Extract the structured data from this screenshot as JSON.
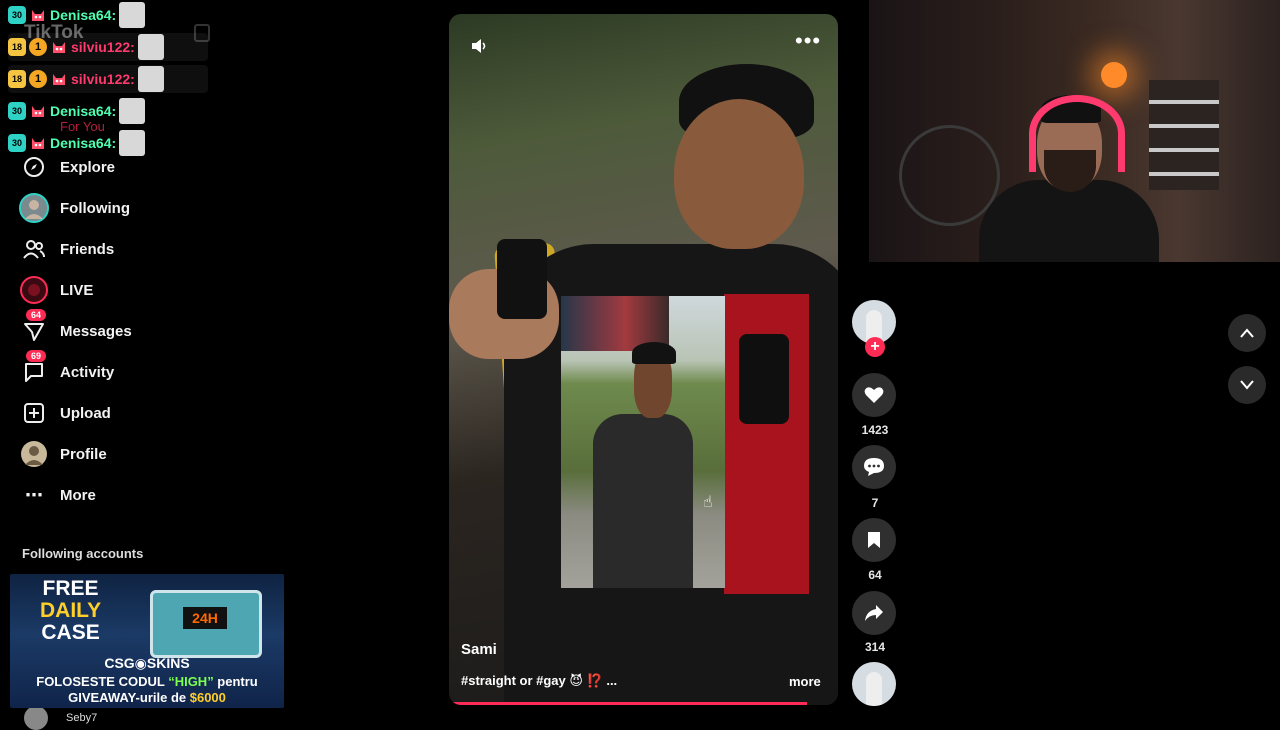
{
  "sidebar": {
    "logo": "TikTok",
    "for_you": "For You",
    "items": [
      {
        "label": "Explore"
      },
      {
        "label": "Following"
      },
      {
        "label": "Friends"
      },
      {
        "label": "LIVE"
      },
      {
        "label": "Messages",
        "badge": "64"
      },
      {
        "label": "Activity",
        "badge": "69"
      },
      {
        "label": "Upload"
      },
      {
        "label": "Profile"
      },
      {
        "label": "More"
      }
    ],
    "following_accounts_title": "Following accounts",
    "following_account_name": "Seby7"
  },
  "chat": [
    {
      "sub_badge": "30",
      "user": "Denisa64:",
      "color": "#4fffb0"
    },
    {
      "age_badge": "18",
      "level_badge": "1",
      "user": "silviu122:",
      "color": "#ff3a6e"
    },
    {
      "age_badge": "18",
      "level_badge": "1",
      "user": "silviu122:",
      "color": "#ff3a6e"
    },
    {
      "sub_badge": "30",
      "user": "Denisa64:",
      "color": "#4fffb0"
    },
    {
      "sub_badge": "30",
      "user": "Denisa64:",
      "color": "#4fffb0"
    }
  ],
  "ad": {
    "line1": "FREE",
    "line2": "DAILY",
    "line3": "CASE",
    "chest_label": "24H",
    "brand": "CSG◉SKINS",
    "promo_part1": "FOLOSESTE CODUL ",
    "promo_code": "“HIGH”",
    "promo_part2": " pentru",
    "promo_line2_part1": "GIVEAWAY-urile de ",
    "promo_amount": "$6000"
  },
  "video": {
    "author": "Sami",
    "caption": "#straight or #gay 😈 ⁉️ ...",
    "more": "more",
    "progress_fraction": 0.92
  },
  "actions": {
    "likes": "1423",
    "comments": "7",
    "saves": "64",
    "shares": "314"
  },
  "colors": {
    "accent": "#fe2c55"
  }
}
